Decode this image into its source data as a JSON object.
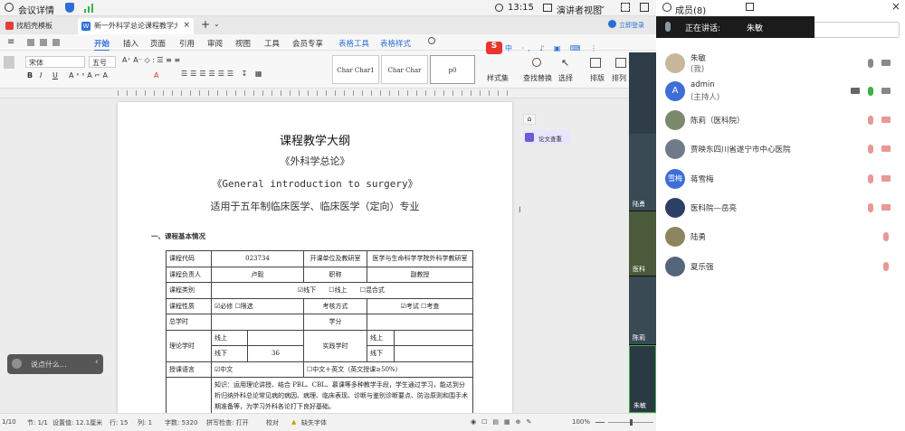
{
  "topbar": {
    "meeting_details": "会议详情",
    "time": "13:15",
    "presenter_view": "演讲者视图",
    "members": "成员(8)"
  },
  "tabs": [
    {
      "label": "找稻壳模板"
    },
    {
      "label": "新一外科学总论课程教学大纲"
    }
  ],
  "login_label": "立即登录",
  "menu": [
    "开始",
    "插入",
    "页面",
    "引用",
    "审阅",
    "视图",
    "工具",
    "会员专享",
    "表格工具",
    "表格样式"
  ],
  "ribbon": {
    "font_name": "宋体",
    "font_size": "五号",
    "style1": "Char Char1",
    "style2": "Char Char",
    "style3": "p0",
    "styles_label": "样式集",
    "find_replace": "查找替换",
    "select": "选择",
    "arrange": "排版",
    "order": "排列"
  },
  "doc": {
    "title": "课程教学大纲",
    "subtitle_cn": "《外科学总论》",
    "subtitle_en": "《General introduction to surgery》",
    "applies": "适用于五年制临床医学、临床医学（定向）专业",
    "section1": "一、课程基本情况",
    "table": {
      "course_code_label": "课程代码",
      "course_code": "023734",
      "unit_label": "开课单位及教研室",
      "unit": "医学与生命科学学院外科学教研室",
      "owner_label": "课程负责人",
      "owner": "卢毅",
      "title_label": "职称",
      "title": "副教授",
      "category_label": "课程类别",
      "cat_offline": "线下",
      "cat_online": "线上",
      "cat_mixed": "混合式",
      "nature_label": "课程性质",
      "required": "必修",
      "elective": "限选",
      "exam_label": "考核方式",
      "exam": "考试",
      "check": "考查",
      "total_hours_label": "总学时",
      "credits_label": "学分",
      "theory_label": "理论学时",
      "online": "线上",
      "offline": "线下",
      "offline_hours": "36",
      "practice_label": "实践学时",
      "lang_label": "授课语言",
      "lang_cn": "中文",
      "lang_mix": "中文＋英文（英文授课≥50%）",
      "knowledge": "知识：运用理论讲授、结合 PBL、CBL、慕课等多种教学手段，学生通过学习，能达到分析归纳外科总论常见病的病因、病理、临床表现、诊断与鉴别诊断要点、防治原则和围手术期准备等，为学习外科各论打下良好基础。"
    }
  },
  "side_tools": {
    "doc_assistant": "论文查重"
  },
  "say_box": "说点什么...",
  "status": {
    "page": "1/10",
    "section": "节: 1/1",
    "setting": "设置值: 12.1厘米",
    "row": "行: 15",
    "col": "列: 1",
    "words": "字数: 5320",
    "spell": "拼写检查: 打开",
    "proof": "校对",
    "missing_font": "缺失字体",
    "zoom": "100%"
  },
  "video_tiles": [
    {
      "label": "陆勇"
    },
    {
      "label": "医科"
    },
    {
      "label": "陈莉"
    },
    {
      "label": "朱敏"
    }
  ],
  "speaking": {
    "label": "正在讲话:",
    "name": "朱敏"
  },
  "participants": [
    {
      "name": "朱敏",
      "role": "(我)",
      "avatar_color": "#c9b79c"
    },
    {
      "name": "admin",
      "role": "(主持人)",
      "avatar_color": "#3d6fd6",
      "initial": "A"
    },
    {
      "name": "陈莉（医科院）",
      "role": "",
      "avatar_color": "#7a8a6a"
    },
    {
      "name": "贾映东四川省遂宁市中心医院",
      "role": "",
      "avatar_color": "#6f7c88"
    },
    {
      "name": "蒋雪梅",
      "role": "",
      "avatar_color": "#3d6fd6",
      "initial": "雪梅"
    },
    {
      "name": "医科院—岳亮",
      "role": "",
      "avatar_color": "#2e3f66"
    },
    {
      "name": "陆勇",
      "role": "",
      "avatar_color": "#8d8460"
    },
    {
      "name": "夏乐强",
      "role": "",
      "avatar_color": "#55657a"
    }
  ],
  "colors": {
    "accent": "#2b6fd6",
    "mic_on": "#3cb04a",
    "mic_off": "#d9534f"
  }
}
